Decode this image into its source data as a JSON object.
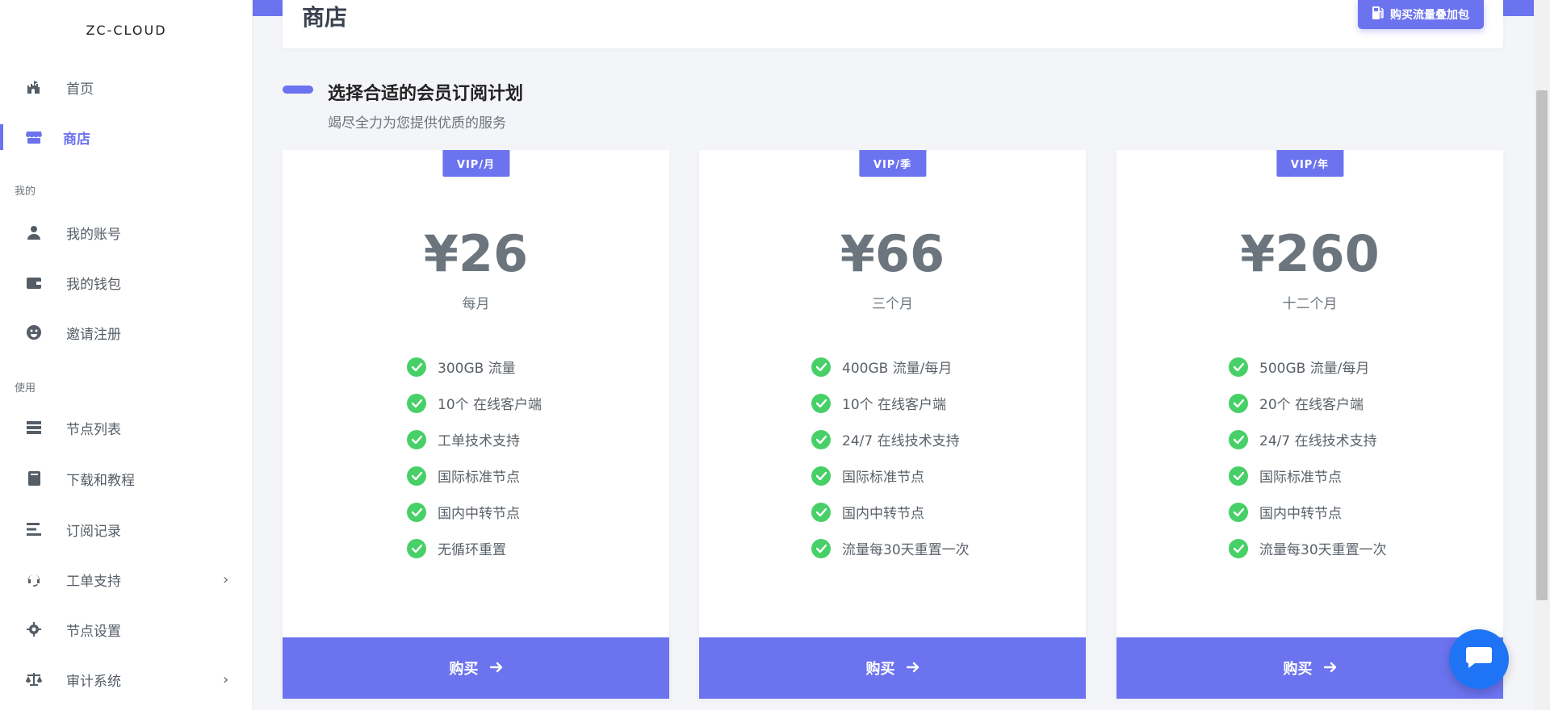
{
  "app": {
    "brand": "ZC-CLOUD"
  },
  "sidebar": {
    "items": [
      {
        "label": "首页",
        "icon": "castle-icon"
      },
      {
        "label": "商店",
        "icon": "store-icon",
        "active": true
      },
      {
        "label": "我的账号",
        "icon": "user-icon"
      },
      {
        "label": "我的钱包",
        "icon": "wallet-icon"
      },
      {
        "label": "邀请注册",
        "icon": "smile-icon"
      },
      {
        "label": "节点列表",
        "icon": "server-icon"
      },
      {
        "label": "下载和教程",
        "icon": "book-icon"
      },
      {
        "label": "订阅记录",
        "icon": "list-icon"
      },
      {
        "label": "工单支持",
        "icon": "headset-icon",
        "has_submenu": true
      },
      {
        "label": "节点设置",
        "icon": "gear-icon"
      },
      {
        "label": "审计系统",
        "icon": "balance-scale-icon",
        "has_submenu": true
      }
    ],
    "sections": {
      "mine": "我的",
      "usage": "使用"
    }
  },
  "header": {
    "title": "商店",
    "addon_button": "购买流量叠加包"
  },
  "plans_section": {
    "title": "选择合适的会员订阅计划",
    "subtitle": "竭尽全力为您提供优质的服务"
  },
  "plans": [
    {
      "badge": "VIP/月",
      "price": "¥26",
      "period": "每月",
      "features": [
        "300GB 流量",
        "10个 在线客户端",
        "工单技术支持",
        "国际标准节点",
        "国内中转节点",
        "无循环重置"
      ],
      "buy_label": "购买"
    },
    {
      "badge": "VIP/季",
      "price": "¥66",
      "period": "三个月",
      "features": [
        "400GB 流量/每月",
        "10个 在线客户端",
        "24/7 在线技术支持",
        "国际标准节点",
        "国内中转节点",
        "流量每30天重置一次"
      ],
      "buy_label": "购买"
    },
    {
      "badge": "VIP/年",
      "price": "¥260",
      "period": "十二个月",
      "features": [
        "500GB 流量/每月",
        "20个 在线客户端",
        "24/7 在线技术支持",
        "国际标准节点",
        "国内中转节点",
        "流量每30天重置一次"
      ],
      "buy_label": "购买"
    }
  ],
  "colors": {
    "accent": "#6b73ef",
    "check": "#48d068",
    "chat": "#1e74f4",
    "background": "#f4f5f9"
  }
}
